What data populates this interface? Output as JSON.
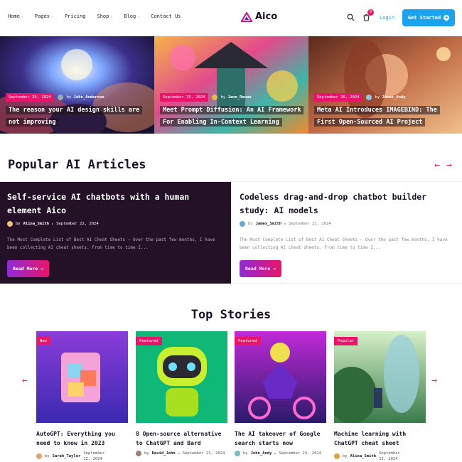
{
  "header": {
    "nav": [
      {
        "label": "Home",
        "dropdown": true
      },
      {
        "label": "Pages",
        "dropdown": true
      },
      {
        "label": "Pricing",
        "dropdown": false
      },
      {
        "label": "Shop",
        "dropdown": true
      },
      {
        "label": "Blog",
        "dropdown": true
      },
      {
        "label": "Contact Us",
        "dropdown": false
      }
    ],
    "logo": "Aico",
    "cart_count": "0",
    "login": "Login",
    "cta": "Get Started",
    "brand_color": "#e8156b",
    "accent_color": "#1ba3ef"
  },
  "hero": [
    {
      "date": "September 24, 2024",
      "author": "John_Anderson",
      "title": "The reason your AI design skills are not improving"
    },
    {
      "date": "September 25, 2024",
      "author": "Jane_Ronan",
      "title": "Meet Prompt Diffusion: An AI Framework For Enabling In-Context Learning"
    },
    {
      "date": "September 26, 2024",
      "author": "James_Andy",
      "title": "Meta AI Introduces IMAGEBIND: The First Open-Sourced AI Project"
    }
  ],
  "popular": {
    "title": "Popular AI Articles",
    "prev_icon": "arrow-left-icon",
    "next_icon": "arrow-right-icon",
    "cards": [
      {
        "title": "Self-service AI chatbots with a human element Aico",
        "by": "by",
        "author": "Alina_Smith",
        "date": "September 22, 2024",
        "excerpt": "The Most Complete List of Best AI Cheat Sheets — Over the past few months, I have been collecting AI cheat sheets. From time to time I...",
        "button": "Read More"
      },
      {
        "title": "Codeless drag-and-drop chatbot builder study: AI models",
        "by": "by",
        "author": "James_Smith",
        "date": "September 21, 2024",
        "excerpt": "The Most Complete List of Best AI Cheat Sheets — Over the past few months, I have been collecting AI cheat sheets. From time to time I...",
        "button": "Read More"
      }
    ]
  },
  "top_stories": {
    "title": "Top Stories",
    "cards": [
      {
        "tag": "New",
        "title": "AutoGPT: Everything you need to know in 2023",
        "by": "by",
        "author": "Sarah_Taylor",
        "date": "September 22, 2024"
      },
      {
        "tag": "Featured",
        "title": "8 Open-source alternative to ChatGPT and Bard",
        "by": "by",
        "author": "David_John",
        "date": "September 21, 2024"
      },
      {
        "tag": "Featured",
        "title": "The AI takeover of Google search starts now",
        "by": "by",
        "author": "John_Andy",
        "date": "September 24, 2024"
      },
      {
        "tag": "Popular",
        "title": "Machine learning with ChatGPT cheat sheet",
        "by": "by",
        "author": "Alina_Smith",
        "date": "September 23, 2024"
      }
    ]
  }
}
